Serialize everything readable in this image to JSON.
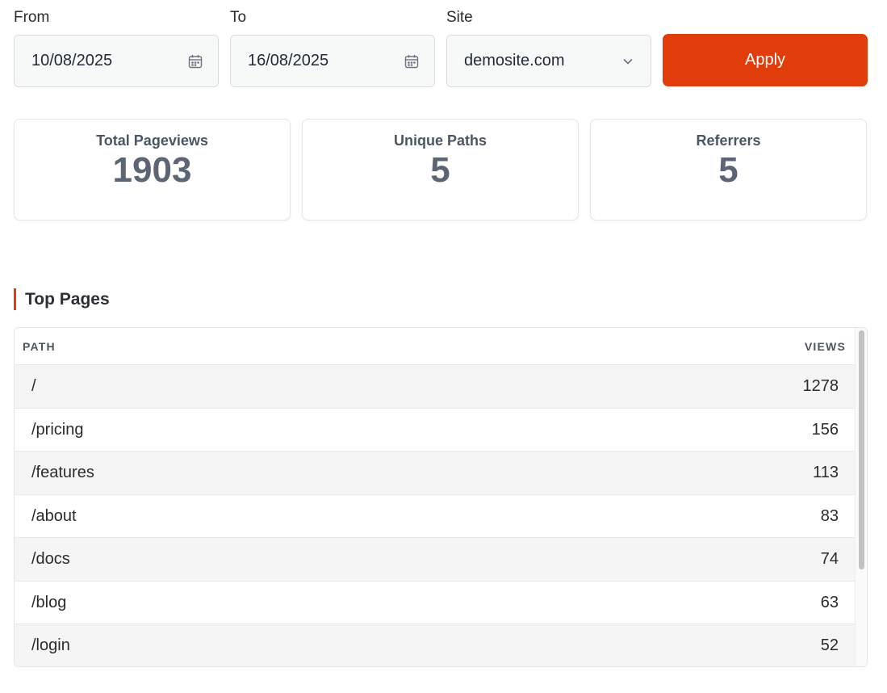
{
  "filters": {
    "from": {
      "label": "From",
      "value": "10/08/2025",
      "icon": "calendar-icon"
    },
    "to": {
      "label": "To",
      "value": "16/08/2025",
      "icon": "calendar-icon"
    },
    "site": {
      "label": "Site",
      "value": "demosite.com",
      "icon": "chevron-down-icon"
    },
    "apply_label": "Apply"
  },
  "stats": [
    {
      "label": "Total Pageviews",
      "value": "1903"
    },
    {
      "label": "Unique Paths",
      "value": "5"
    },
    {
      "label": "Referrers",
      "value": "5"
    }
  ],
  "top_pages": {
    "title": "Top Pages",
    "columns": {
      "path": "PATH",
      "views": "VIEWS"
    },
    "rows": [
      {
        "path": "/",
        "views": "1278"
      },
      {
        "path": "/pricing",
        "views": "156"
      },
      {
        "path": "/features",
        "views": "113"
      },
      {
        "path": "/about",
        "views": "83"
      },
      {
        "path": "/docs",
        "views": "74"
      },
      {
        "path": "/blog",
        "views": "63"
      },
      {
        "path": "/login",
        "views": "52"
      }
    ]
  },
  "colors": {
    "accent": "#e13d0b",
    "input_bg": "#f7f9f9",
    "row_alt": "#f6f5f6",
    "stat_value": "#5c6574"
  }
}
